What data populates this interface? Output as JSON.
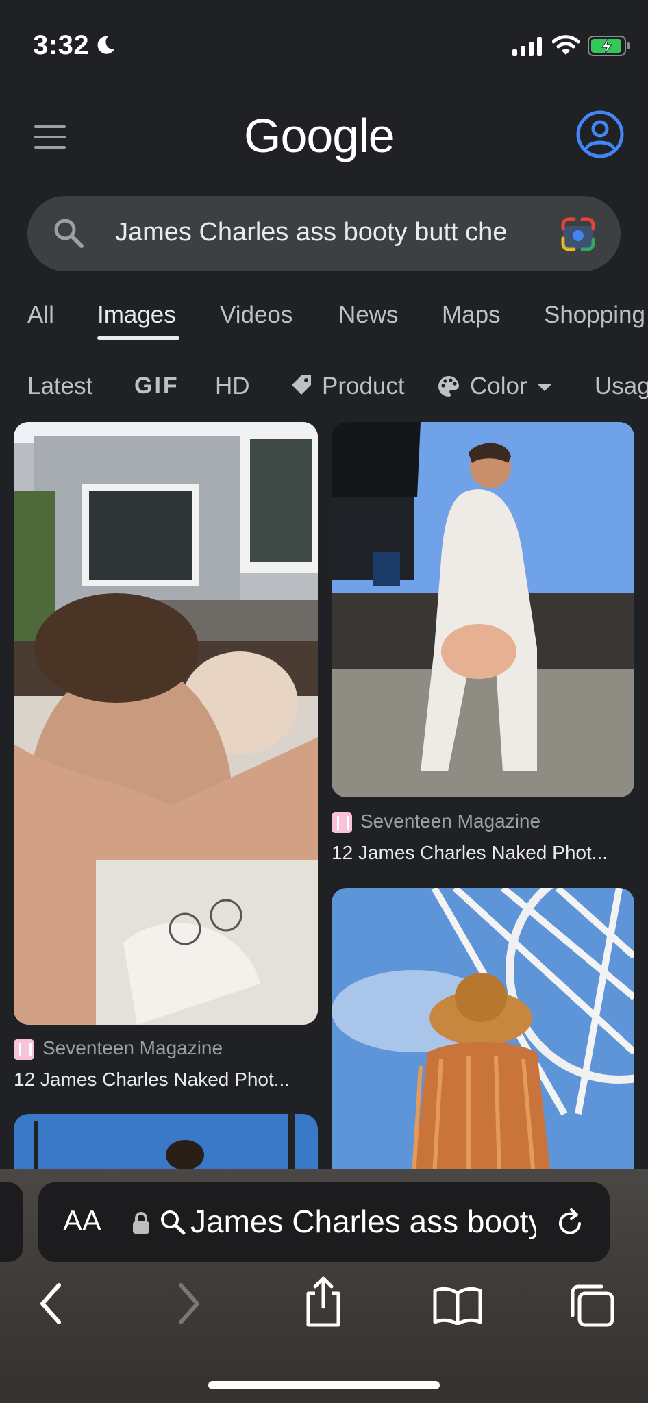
{
  "status_bar": {
    "time": "3:32"
  },
  "header": {
    "logo_text": "Google"
  },
  "search": {
    "query": "James Charles ass booty butt che"
  },
  "tabs": [
    {
      "label": "All"
    },
    {
      "label": "Images",
      "active": true
    },
    {
      "label": "Videos"
    },
    {
      "label": "News"
    },
    {
      "label": "Maps"
    },
    {
      "label": "Shopping"
    }
  ],
  "filters": [
    {
      "label": "Latest"
    },
    {
      "label": "GIF"
    },
    {
      "label": "HD"
    },
    {
      "label": "Product",
      "icon": "tag-icon"
    },
    {
      "label": "Color",
      "icon": "palette-icon"
    },
    {
      "label": "Usage"
    }
  ],
  "results": [
    {
      "source": "Seventeen Magazine",
      "title": "12 James Charles Naked Phot..."
    },
    {
      "source": "Seventeen Magazine",
      "title": "12 James Charles Naked Phot..."
    }
  ],
  "safari": {
    "reader_label": "AA",
    "address_text": "James Charles ass booty butt che"
  },
  "colors": {
    "accent_blue": "#4285f4",
    "background": "#202124",
    "search_box": "#3c4043"
  }
}
